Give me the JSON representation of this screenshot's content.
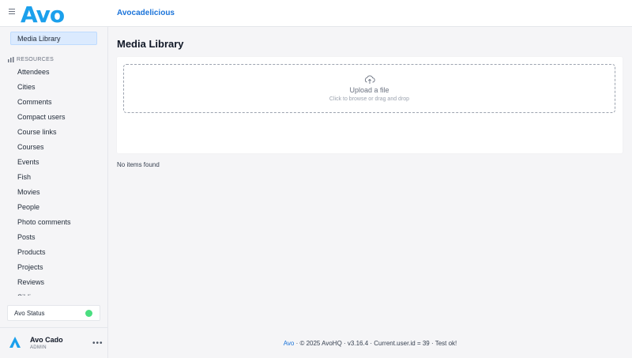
{
  "header": {
    "logo": "Avo",
    "brand_link": "Avocadelicious"
  },
  "sidebar": {
    "media_library": "Media Library",
    "resources_label": "RESOURCES",
    "items": [
      "Attendees",
      "Cities",
      "Comments",
      "Compact users",
      "Course links",
      "Courses",
      "Events",
      "Fish",
      "Movies",
      "People",
      "Photo comments",
      "Posts",
      "Products",
      "Projects",
      "Reviews",
      "Siblings"
    ],
    "status_label": "Avo Status",
    "status_color": "#4ade80"
  },
  "user": {
    "name": "Avo Cado",
    "role": "ADMIN",
    "menu_icon": "ellipsis-icon"
  },
  "main": {
    "title": "Media Library",
    "upload_title": "Upload a file",
    "upload_hint": "Click to browse or drag and drop",
    "empty": "No items found"
  },
  "footer": {
    "link": "Avo",
    "text": " · © 2025 AvoHQ · v3.16.4 · Current.user.id = 39 · Test ok!"
  },
  "colors": {
    "accent": "#1a73d9",
    "logo": "#1ba0ec"
  }
}
